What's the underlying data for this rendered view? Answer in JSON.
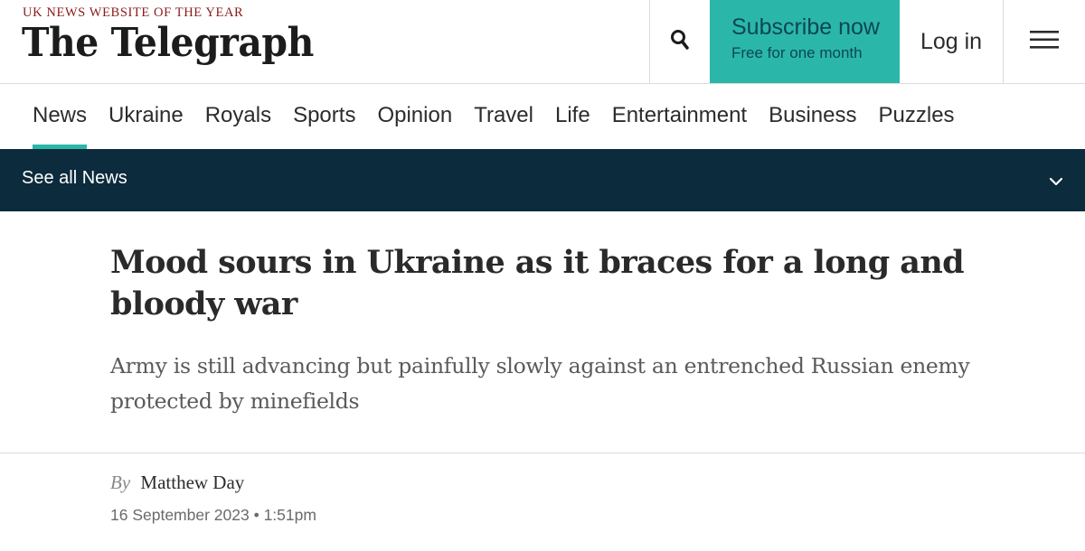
{
  "header": {
    "tagline": "UK NEWS WEBSITE OF THE YEAR",
    "logo_text": "The Telegraph",
    "search_icon": "search-icon",
    "subscribe_main": "Subscribe now",
    "subscribe_sub": "Free for one month",
    "login_label": "Log in",
    "menu_icon": "hamburger-menu-icon"
  },
  "nav": {
    "items": [
      {
        "label": "News",
        "active": true
      },
      {
        "label": "Ukraine"
      },
      {
        "label": "Royals"
      },
      {
        "label": "Sports"
      },
      {
        "label": "Opinion"
      },
      {
        "label": "Travel"
      },
      {
        "label": "Life"
      },
      {
        "label": "Entertainment"
      },
      {
        "label": "Business"
      },
      {
        "label": "Puzzles"
      }
    ]
  },
  "section_bar": {
    "label": "See all News",
    "icon": "chevron-down-icon"
  },
  "article": {
    "headline": "Mood sours in Ukraine as it braces for a long and bloody war",
    "standfirst": "Army is still advancing but painfully slowly against an entrenched Russian enemy protected by minefields",
    "byline_prefix": "By",
    "author": "Matthew Day",
    "date": "16 September 2023 • 1:51pm"
  },
  "colors": {
    "accent_teal": "#2ab7a9",
    "section_bar_bg": "#0c2b3c",
    "tagline_red": "#8b1a1a"
  }
}
